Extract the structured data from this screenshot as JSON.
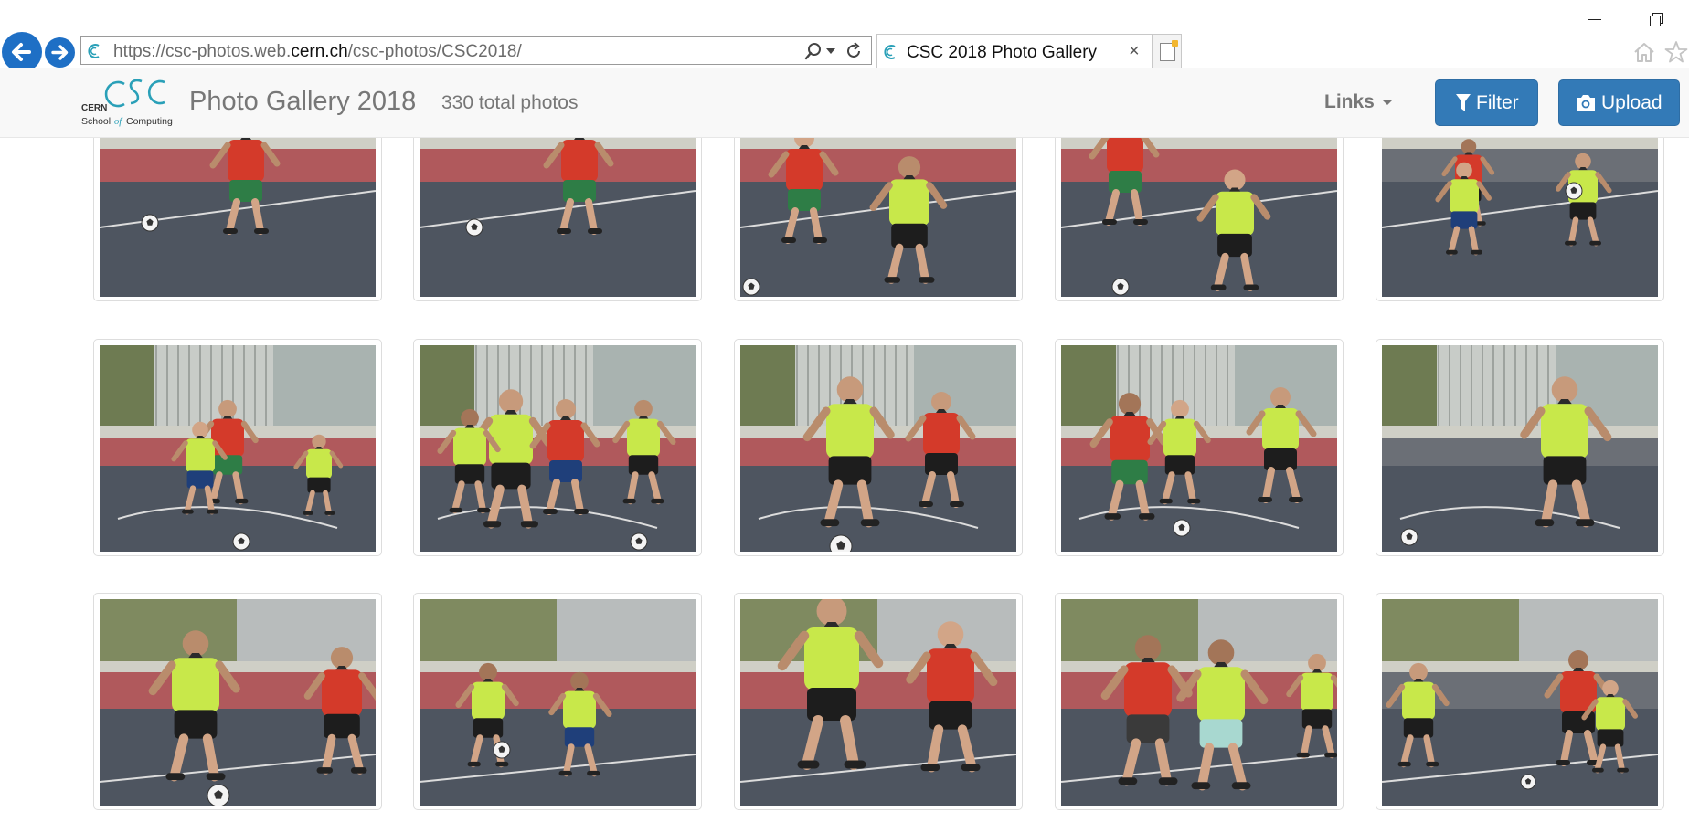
{
  "browser": {
    "url_prefix": "https://csc-photos.web.",
    "url_domain": "cern.ch",
    "url_path": "/csc-photos/CSC2018/",
    "tab_title": "CSC 2018 Photo Gallery",
    "tab_close": "×"
  },
  "header": {
    "logo_line1": "CERN",
    "logo_line2_a": "School",
    "logo_line2_of": "of",
    "logo_line2_b": "Computing",
    "logo_mark": "CSC",
    "title": "Photo Gallery 2018",
    "total_photos": "330 total photos",
    "links_label": "Links",
    "filter_label": "Filter",
    "upload_label": "Upload"
  },
  "colors": {
    "accent": "#337ab7",
    "nav_blue": "#1e6fc5",
    "court": "#4e5560",
    "track": "#b0595c",
    "grass": "#8c8a4c",
    "bib_yellow": "#c8e84a",
    "bib_red": "#d43a2a"
  },
  "photos": [
    {
      "scene": "red-bib-player-ball-left"
    },
    {
      "scene": "red-bib-player-ball-left"
    },
    {
      "scene": "red-and-yellow-players-tackle"
    },
    {
      "scene": "red-and-yellow-players-goalkeeper"
    },
    {
      "scene": "group-of-players-near-fence"
    },
    {
      "scene": "players-near-bicycles-and-fence"
    },
    {
      "scene": "players-dribbling-near-fence"
    },
    {
      "scene": "yellow-bib-player-dribbling"
    },
    {
      "scene": "red-and-yellow-players-running"
    },
    {
      "scene": "yellow-bib-player-running"
    },
    {
      "scene": "yellow-bib-player-kicking"
    },
    {
      "scene": "player-near-tall-fence"
    },
    {
      "scene": "yellow-bib-player-close-up"
    },
    {
      "scene": "players-in-front-of-goal"
    },
    {
      "scene": "players-in-parking-area"
    }
  ]
}
